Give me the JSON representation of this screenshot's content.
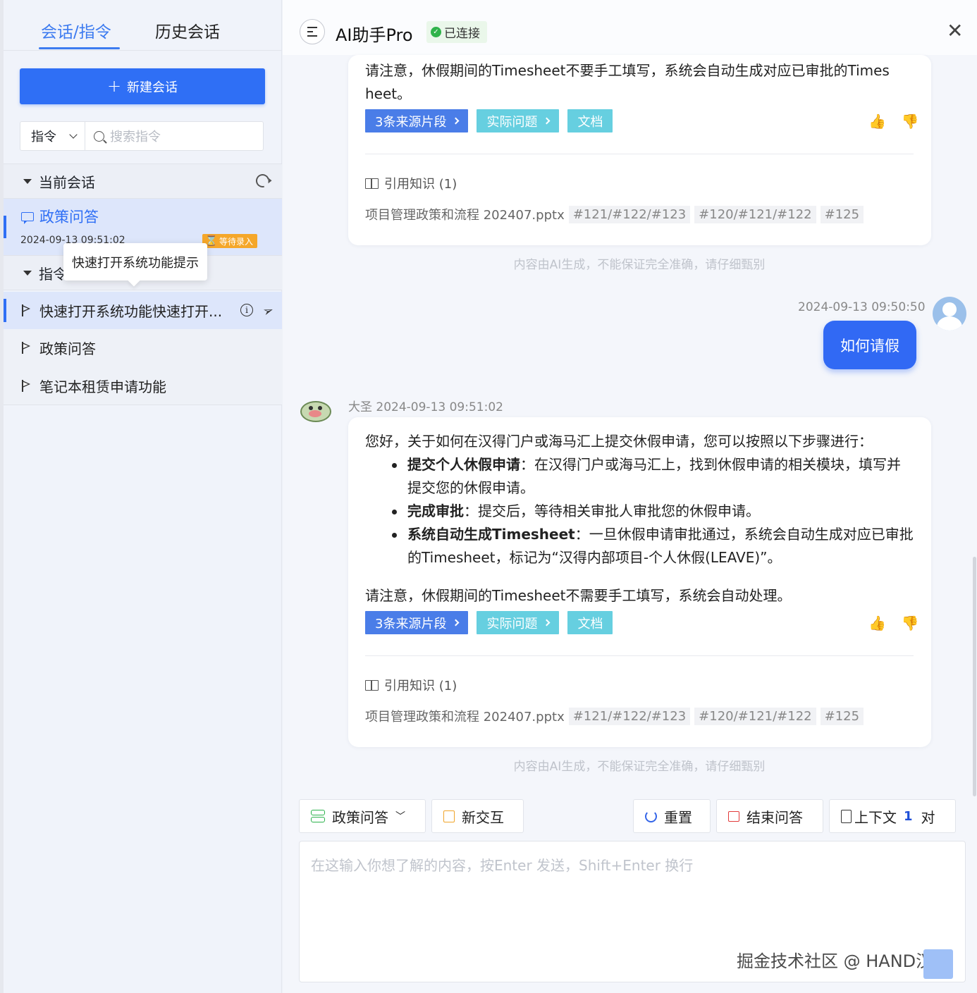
{
  "sidebar": {
    "tabs": [
      "会话/指令",
      "历史会话"
    ],
    "new_button": "新建会话",
    "filter_select": "指令",
    "search_placeholder": "搜索指令",
    "current_section": "当前会话",
    "conversation": {
      "title": "政策问答",
      "time": "2024-09-13 09:51:02",
      "badge": "等待录入"
    },
    "command_section": "指令",
    "tooltip": "快速打开系统功能提示",
    "commands": [
      "快速打开系统功能快速打开...",
      "政策问答",
      "笔记本租赁申请功能"
    ]
  },
  "header": {
    "title": "AI助手Pro",
    "status": "已连接",
    "status_color": "#2fb34a"
  },
  "messages": {
    "first_card": {
      "text_line1": "请注意，休假期间的Timesheet不要手工填写，系统会自动生成对应已审批的Times",
      "text_line2": "heet。"
    },
    "tags": [
      "3条来源片段",
      "实际问题",
      "文档"
    ],
    "ref_title": "引用知识 (1)",
    "ref_file": "项目管理政策和流程 202407.pptx",
    "ref_chips": [
      "#121/#122/#123",
      "#120/#121/#122",
      "#125"
    ],
    "disclaimer": "内容由AI生成，不能保证完全准确，请仔细甄别",
    "user": {
      "time": "2024-09-13 09:50:50",
      "text": "如何请假"
    },
    "bot": {
      "name": "大圣 2024-09-13 09:51:02",
      "intro": "您好，关于如何在汉得门户或海马汇上提交休假申请，您可以按照以下步骤进行：",
      "bullets": [
        {
          "bold": "提交个人休假申请",
          "text": "：在汉得门户或海马汇上，找到休假申请的相关模块，填写并提交您的休假申请。"
        },
        {
          "bold": "完成审批",
          "text": "：提交后，等待相关审批人审批您的休假申请。"
        },
        {
          "bold": "系统自动生成Timesheet",
          "text": "：一旦休假申请审批通过，系统会自动生成对应已审批的Timesheet，标记为“汉得内部项目-个人休假(LEAVE)”。"
        }
      ],
      "note": "请注意，休假期间的Timesheet不需要手工填写，系统会自动处理。"
    }
  },
  "toolbar": {
    "mode": "政策问答",
    "new_interaction": "新交互",
    "reset": "重置",
    "end": "结束问答",
    "context_label": "上下文",
    "context_count": "1",
    "context_unit": "对"
  },
  "input": {
    "placeholder": "在这输入你想了解的内容，按Enter 发送，Shift+Enter 换行"
  },
  "watermark": "掘金技术社区 @ HAND汉得",
  "colors": {
    "primary": "#2f6ff5",
    "tag_blue": "#4a7de8",
    "tag_cyan": "#66cfe0",
    "badge": "#f5a72a"
  }
}
